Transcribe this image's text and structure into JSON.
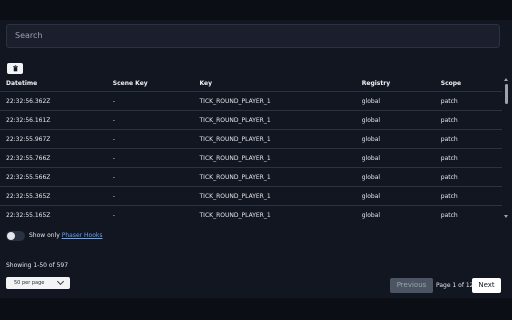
{
  "search": {
    "placeholder": "Search"
  },
  "toolbar": {
    "clear_icon": "trash-icon"
  },
  "table": {
    "columns": [
      "Datetime",
      "Scene Key",
      "Key",
      "Registry",
      "Scope"
    ],
    "rows": [
      [
        "22:32:56.362Z",
        "-",
        "TICK_ROUND_PLAYER_1",
        "global",
        "patch"
      ],
      [
        "22:32:56.161Z",
        "-",
        "TICK_ROUND_PLAYER_1",
        "global",
        "patch"
      ],
      [
        "22:32:55.967Z",
        "-",
        "TICK_ROUND_PLAYER_1",
        "global",
        "patch"
      ],
      [
        "22:32:55.766Z",
        "-",
        "TICK_ROUND_PLAYER_1",
        "global",
        "patch"
      ],
      [
        "22:32:55.566Z",
        "-",
        "TICK_ROUND_PLAYER_1",
        "global",
        "patch"
      ],
      [
        "22:32:55.365Z",
        "-",
        "TICK_ROUND_PLAYER_1",
        "global",
        "patch"
      ],
      [
        "22:32:55.165Z",
        "-",
        "TICK_ROUND_PLAYER_1",
        "global",
        "patch"
      ],
      [
        "",
        "",
        "",
        "",
        ""
      ]
    ]
  },
  "filter": {
    "label": "Show only",
    "link": "Phaser Hooks",
    "enabled": false
  },
  "pagination": {
    "showing": "Showing 1-50 of 597",
    "per_page": "50 per page",
    "prev": "Previous",
    "page_info": "Page 1 of 12",
    "next": "Next"
  }
}
